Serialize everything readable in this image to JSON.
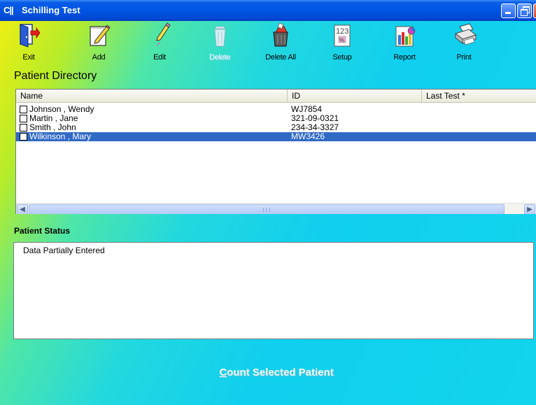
{
  "window": {
    "logo": "C||",
    "title": "Schilling Test"
  },
  "toolbar": {
    "items": [
      {
        "label": "Exit",
        "icon": "exit-door-icon"
      },
      {
        "label": "Add",
        "icon": "add-note-pencil-icon"
      },
      {
        "label": "Edit",
        "icon": "edit-pencil-icon"
      },
      {
        "label": "Delete",
        "icon": "trash-can-icon",
        "disabled": true
      },
      {
        "label": "Delete All",
        "icon": "trash-bin-full-icon"
      },
      {
        "label": "Setup",
        "icon": "setup-calculator-icon"
      },
      {
        "label": "Report",
        "icon": "report-chart-icon"
      },
      {
        "label": "Print",
        "icon": "printer-icon"
      }
    ]
  },
  "directory": {
    "title": "Patient Directory",
    "columns": [
      "Name",
      "ID",
      "Last Test *"
    ],
    "rows": [
      {
        "name": "Johnson , Wendy",
        "id": "WJ7854",
        "last_test": "",
        "selected": false
      },
      {
        "name": "Martin , Jane",
        "id": "321-09-0321",
        "last_test": "",
        "selected": false
      },
      {
        "name": "Smith , John",
        "id": "234-34-3327",
        "last_test": "",
        "selected": false
      },
      {
        "name": "Wilkinson , Mary",
        "id": "MW3426",
        "last_test": "",
        "selected": true
      }
    ]
  },
  "status": {
    "title": "Patient Status",
    "text": "Data Partially Entered"
  },
  "count_button": {
    "label": "Count Selected Patient",
    "disabled": true
  },
  "colors": {
    "selection": "#316ac5",
    "titlebar": "#0055e4"
  }
}
